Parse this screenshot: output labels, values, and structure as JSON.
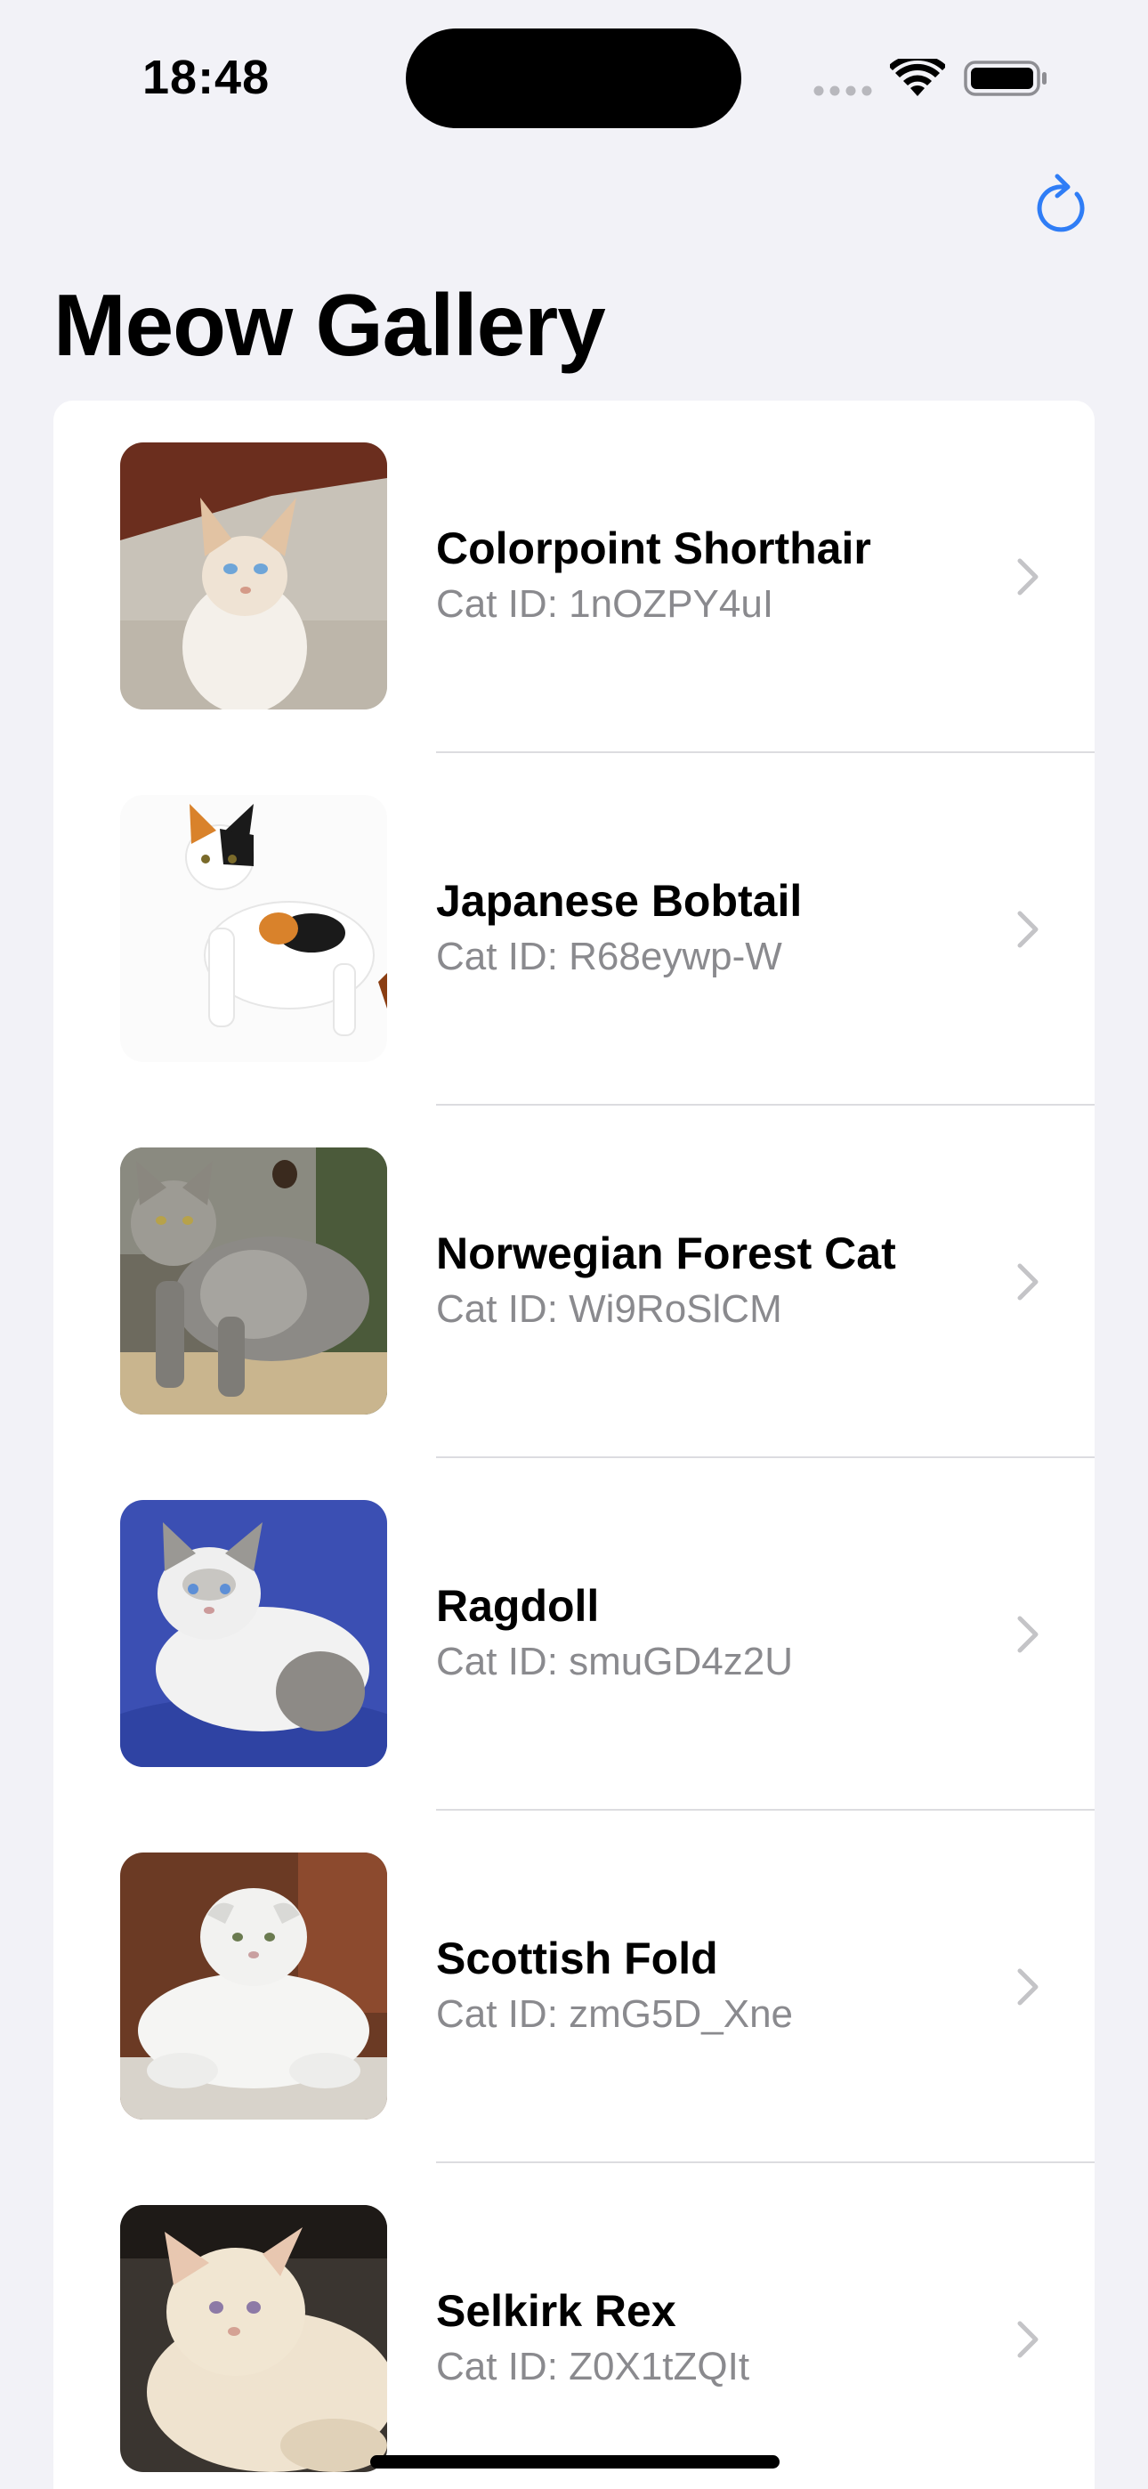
{
  "status_bar": {
    "time": "18:48"
  },
  "nav": {
    "refresh_icon": "arrow-clockwise-icon",
    "accent_color": "#2f7df6"
  },
  "title": "Meow Gallery",
  "cats": [
    {
      "name": "Colorpoint Shorthair",
      "subtitle": "Cat ID: 1nOZPY4uI"
    },
    {
      "name": "Japanese Bobtail",
      "subtitle": "Cat ID: R68eywp-W"
    },
    {
      "name": "Norwegian Forest Cat",
      "subtitle": "Cat ID: Wi9RoSlCM"
    },
    {
      "name": "Ragdoll",
      "subtitle": "Cat ID: smuGD4z2U"
    },
    {
      "name": "Scottish Fold",
      "subtitle": "Cat ID: zmG5D_Xne"
    },
    {
      "name": "Selkirk Rex",
      "subtitle": "Cat ID: Z0X1tZQIt"
    }
  ]
}
